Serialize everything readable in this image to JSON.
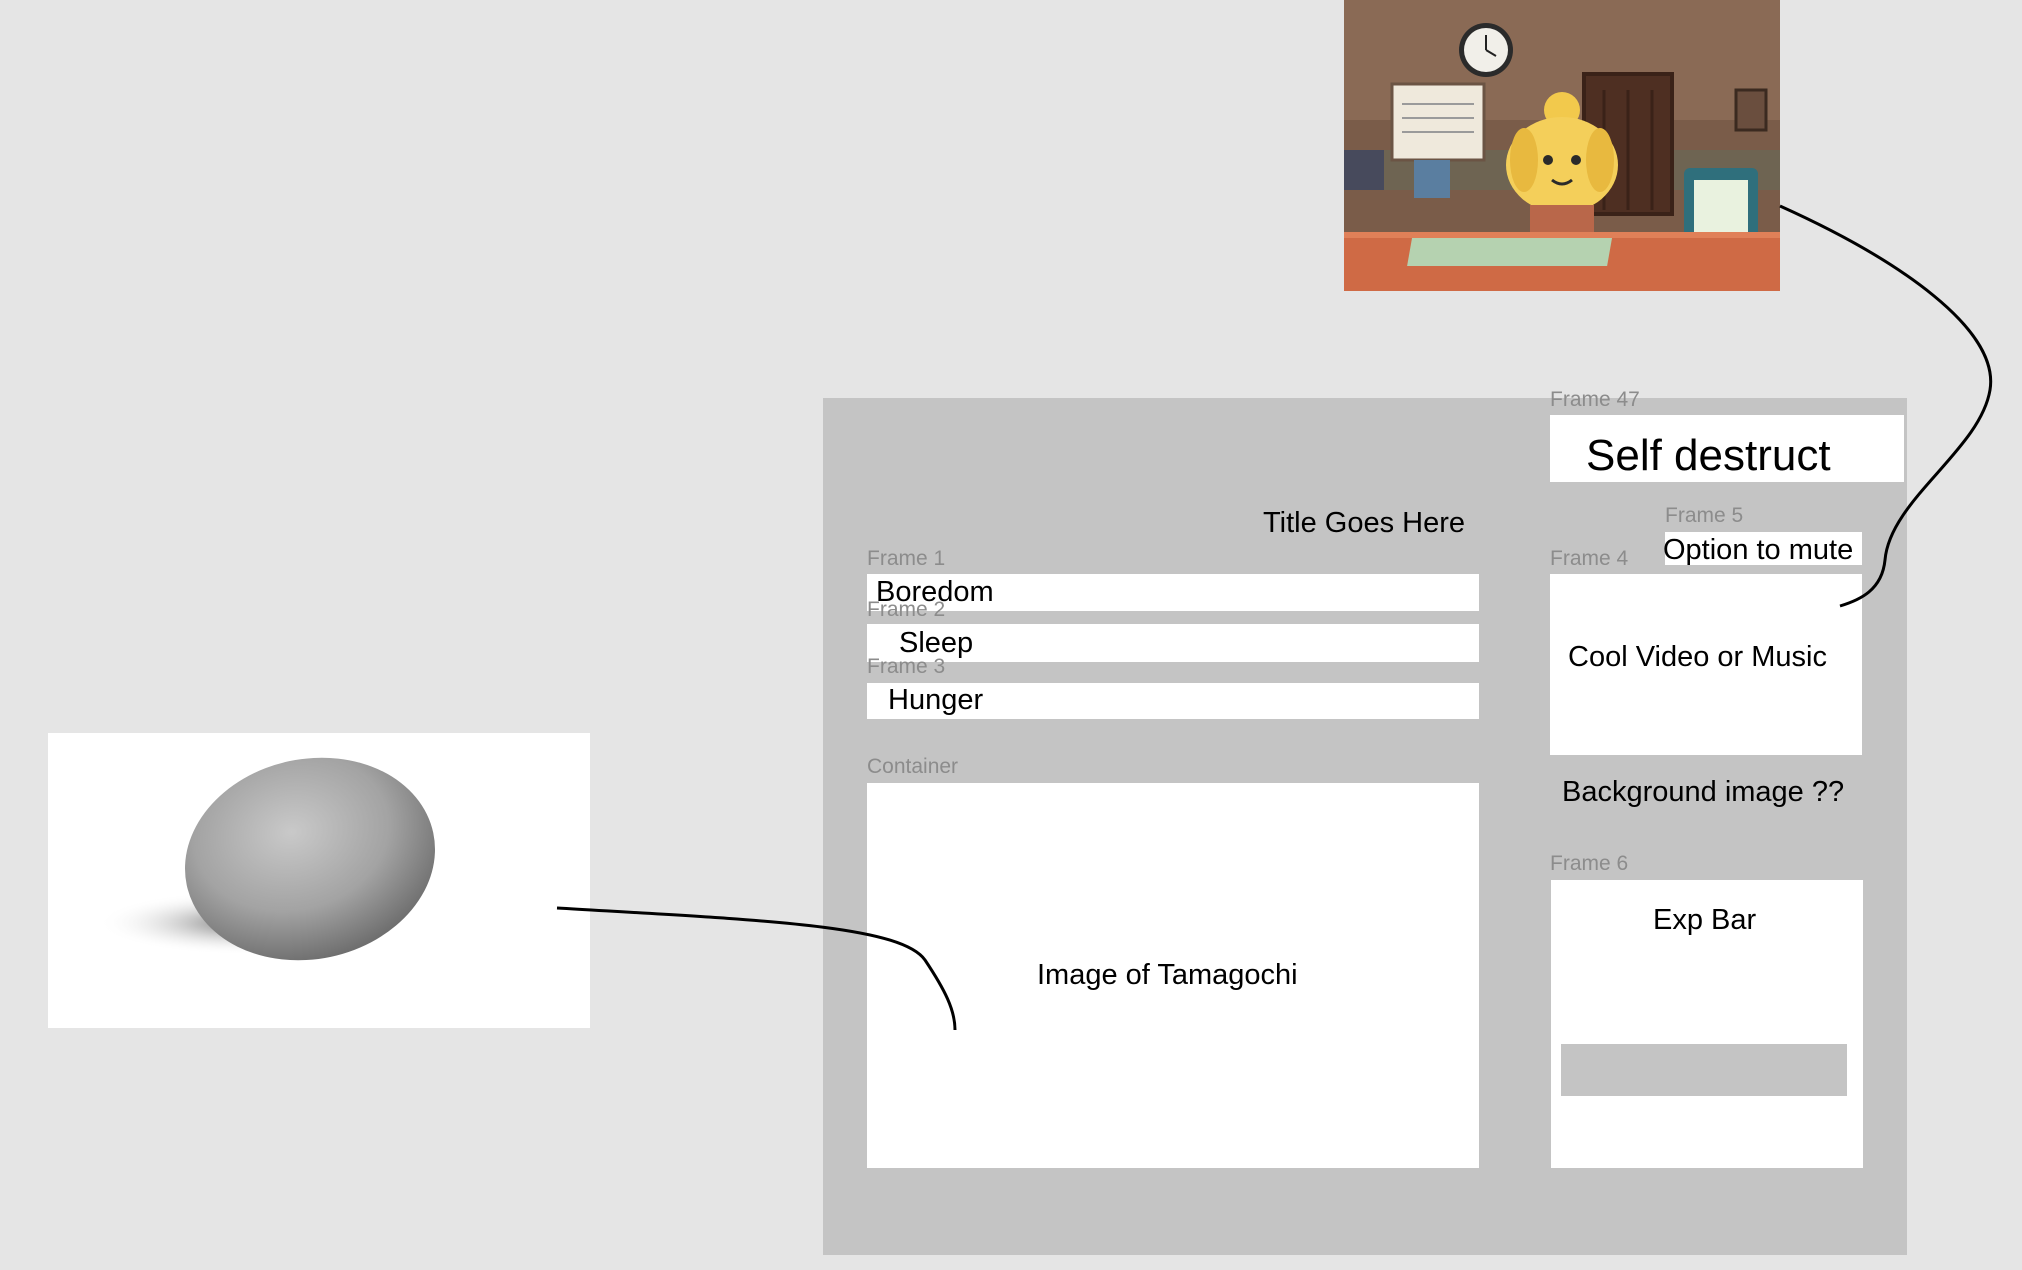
{
  "canvas": {
    "background": "#e5e5e5",
    "panel_color": "#c4c4c4",
    "frame_fill": "#ffffff",
    "label_color": "#8c8c8c"
  },
  "main": {
    "title": "Title Goes Here",
    "frames": [
      {
        "label": "Frame 1",
        "text": "Boredom"
      },
      {
        "label": "Frame 2",
        "text": "Sleep"
      },
      {
        "label": "Frame 3",
        "text": "Hunger"
      }
    ],
    "container": {
      "label": "Container",
      "text": "Image of Tamagochi"
    }
  },
  "sidebar": {
    "frame47": {
      "label": "Frame 47",
      "text": "Self destruct"
    },
    "frame5": {
      "label": "Frame 5",
      "text": "Option to mute"
    },
    "frame4": {
      "label": "Frame 4",
      "text": "Cool Video or Music"
    },
    "background_note": "Background image ??",
    "frame6": {
      "label": "Frame 6",
      "text": "Exp Bar"
    }
  },
  "images": {
    "stone": "stone-photo",
    "game": "game-screenshot"
  }
}
